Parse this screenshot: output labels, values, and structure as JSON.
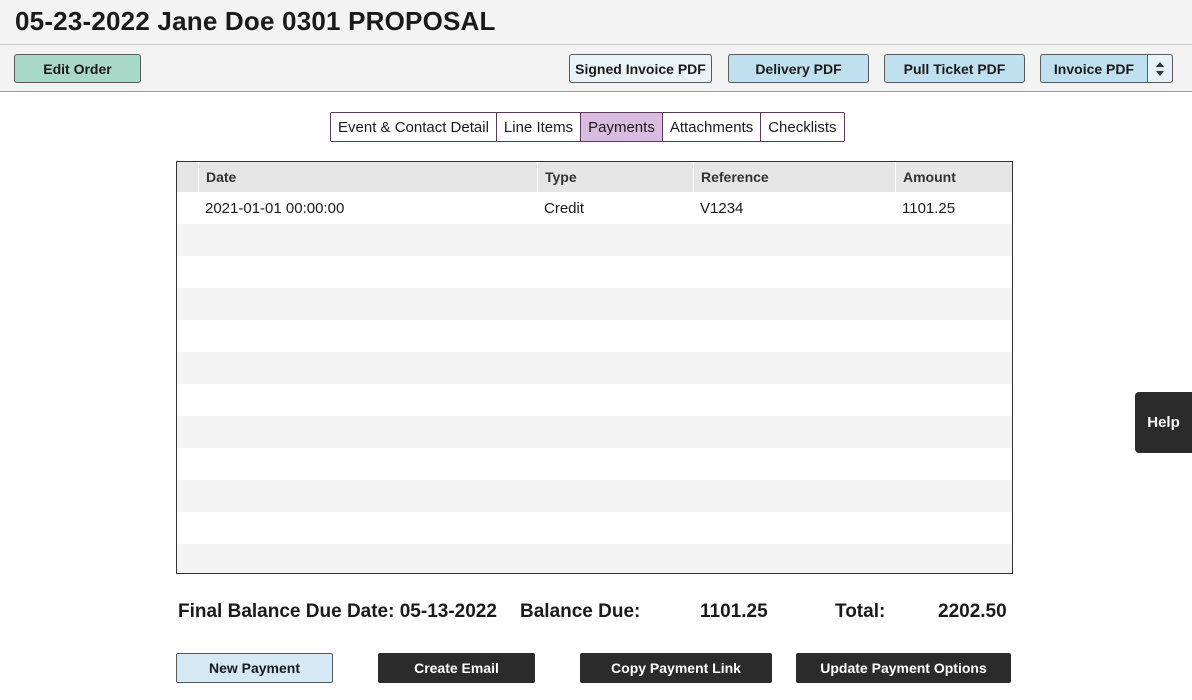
{
  "page": {
    "title": "05-23-2022 Jane Doe 0301 PROPOSAL"
  },
  "toolbar": {
    "edit_order": "Edit Order",
    "signed_invoice_pdf": "Signed Invoice PDF",
    "delivery_pdf": "Delivery PDF",
    "pull_ticket_pdf": "Pull Ticket PDF",
    "invoice_pdf": "Invoice PDF"
  },
  "tabs": [
    {
      "label": "Event & Contact Detail",
      "active": false
    },
    {
      "label": "Line Items",
      "active": false
    },
    {
      "label": "Payments",
      "active": true
    },
    {
      "label": "Attachments",
      "active": false
    },
    {
      "label": "Checklists",
      "active": false
    }
  ],
  "payments_table": {
    "columns": [
      "Date",
      "Type",
      "Reference",
      "Amount"
    ],
    "rows": [
      {
        "date": "2021-01-01 00:00:00",
        "type": "Credit",
        "reference": "V1234",
        "amount": "1101.25"
      }
    ]
  },
  "summary": {
    "final_balance_due_date": "Final Balance Due Date: 05-13-2022",
    "balance_due_label": "Balance Due:",
    "balance_due_value": "1101.25",
    "total_label": "Total:",
    "total_value": "2202.50"
  },
  "actions": {
    "new_payment": "New Payment",
    "create_email": "Create Email",
    "copy_payment_link": "Copy Payment Link",
    "update_payment_options": "Update Payment Options"
  },
  "help": {
    "label": "Help"
  },
  "colors": {
    "edit_order_bg": "#a8d8c8",
    "pdf_button_bg": "#bfe0ee",
    "active_tab_bg": "#d9bde0",
    "dark_button_bg": "#2b2b2b"
  }
}
